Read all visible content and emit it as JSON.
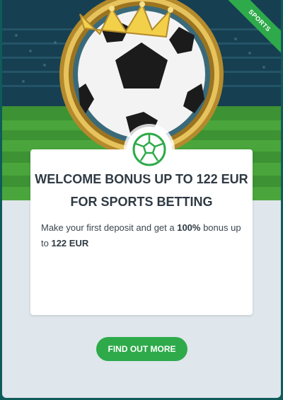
{
  "promo": {
    "ribbon": "SPORTS",
    "title_line1": "WELCOME BONUS UP TO 122 EUR",
    "title_line2": "FOR SPORTS BETTING",
    "desc_pre": "Make your first deposit and get a ",
    "desc_percent": "100%",
    "desc_mid": " bonus up to ",
    "desc_amount": "122 EUR",
    "cta_label": "FIND OUT MORE"
  },
  "colors": {
    "accent": "#2eaa4a",
    "title_text": "#2f3a43",
    "background": "#dfe6ec",
    "frame": "#0e5b5a"
  },
  "icons": {
    "hero": "soccer-ball-crown-icon",
    "badge": "soccer-ball-outline-icon"
  }
}
